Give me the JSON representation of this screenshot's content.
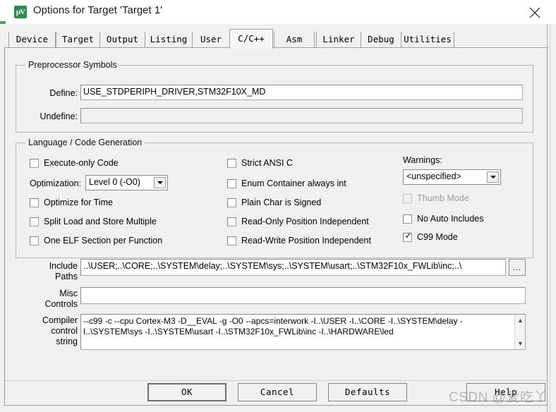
{
  "window": {
    "title": "Options for Target 'Target 1'",
    "icon": "uvision-logo-icon",
    "close_label": "✕"
  },
  "tabs": {
    "items": [
      {
        "label": "Device",
        "active": false
      },
      {
        "label": "Target",
        "active": false
      },
      {
        "label": "Output",
        "active": false
      },
      {
        "label": "Listing",
        "active": false
      },
      {
        "label": "User",
        "active": false
      },
      {
        "label": "C/C++",
        "active": true
      },
      {
        "label": "Asm",
        "active": false
      },
      {
        "label": "Linker",
        "active": false
      },
      {
        "label": "Debug",
        "active": false
      },
      {
        "label": "Utilities",
        "active": false
      }
    ]
  },
  "preprocessor": {
    "group_label": "Preprocessor Symbols",
    "define_label": "Define:",
    "define_value": "USE_STDPERIPH_DRIVER,STM32F10X_MD",
    "undefine_label": "Undefine:",
    "undefine_value": ""
  },
  "language": {
    "group_label": "Language / Code Generation",
    "optimization_label": "Optimization:",
    "optimization_value": "Level 0 (-O0)",
    "warnings_label": "Warnings:",
    "warnings_value": "<unspecified>",
    "left_checks": [
      {
        "label": "Execute-only Code",
        "checked": false,
        "enabled": true
      },
      {
        "label": "Optimize for Time",
        "checked": false,
        "enabled": true
      },
      {
        "label": "Split Load and Store Multiple",
        "checked": false,
        "enabled": true
      },
      {
        "label": "One ELF Section per Function",
        "checked": false,
        "enabled": true
      }
    ],
    "mid_checks": [
      {
        "label": "Strict ANSI C",
        "checked": false,
        "enabled": true
      },
      {
        "label": "Enum Container always int",
        "checked": false,
        "enabled": true
      },
      {
        "label": "Plain Char is Signed",
        "checked": false,
        "enabled": true
      },
      {
        "label": "Read-Only Position Independent",
        "checked": false,
        "enabled": true
      },
      {
        "label": "Read-Write Position Independent",
        "checked": false,
        "enabled": true
      }
    ],
    "right_checks": [
      {
        "label": "Thumb Mode",
        "checked": false,
        "enabled": false
      },
      {
        "label": "No Auto Includes",
        "checked": false,
        "enabled": true
      },
      {
        "label": "C99 Mode",
        "checked": true,
        "enabled": true
      }
    ]
  },
  "paths": {
    "include_label_line1": "Include",
    "include_label_line2": "Paths",
    "include_value": "..\\USER;..\\CORE;..\\SYSTEM\\delay;..\\SYSTEM\\sys;..\\SYSTEM\\usart;..\\STM32F10x_FWLib\\inc;..\\",
    "browse_label": "...",
    "misc_label_line1": "Misc",
    "misc_label_line2": "Controls",
    "misc_value": "",
    "compiler_label_line1": "Compiler",
    "compiler_label_line2": "control",
    "compiler_label_line3": "string",
    "compiler_value": "--c99 -c --cpu Cortex-M3 -D__EVAL -g -O0 --apcs=interwork -I..\\USER -I..\\CORE -I..\\SYSTEM\\delay -I..\\SYSTEM\\sys -I..\\SYSTEM\\usart -I..\\STM32F10x_FWLib\\inc -I..\\HARDWARE\\led",
    "scroll_up": "▲",
    "scroll_down": "▼"
  },
  "buttons": {
    "ok": "OK",
    "cancel": "Cancel",
    "defaults": "Defaults",
    "help": "Help"
  },
  "watermark": {
    "text": "CSDN @爱吃丫"
  },
  "colors": {
    "dialog_bg": "#f0f0f0",
    "titlebar_bg": "#ffffff",
    "field_bg": "#ffffff",
    "border": "#b4b4b4",
    "accent_green": "#2e8b4f",
    "text": "#000000",
    "disabled_text": "#9d9d9d"
  }
}
